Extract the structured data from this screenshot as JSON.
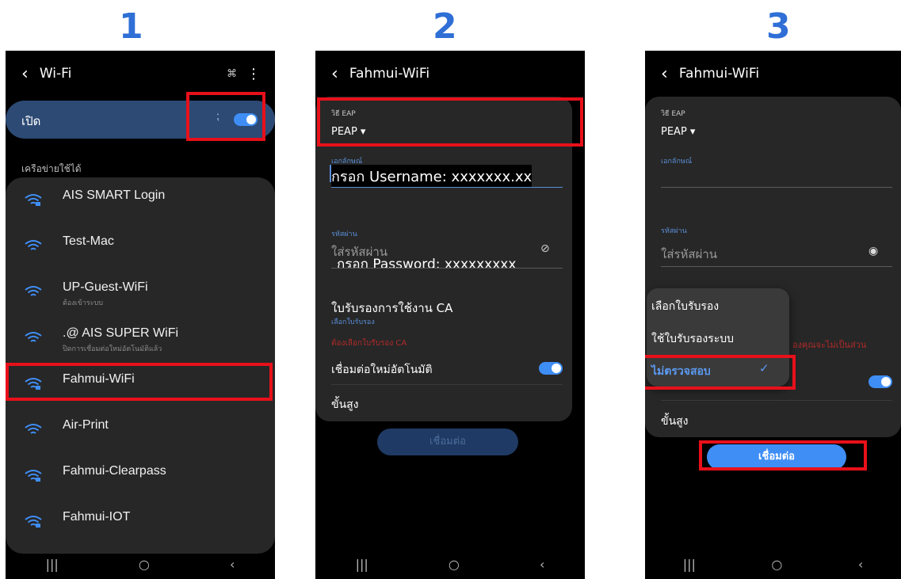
{
  "steps": [
    "1",
    "2",
    "3"
  ],
  "colors": {
    "highlight": "#e8101a",
    "accent": "#3f8ef6",
    "step_number": "#2f6fd6"
  },
  "screen1": {
    "title": "Wi-Fi",
    "toggle_label": "เปิด",
    "section_label": "เครือข่ายใช้ได้",
    "networks": [
      {
        "name": "AIS SMART Login",
        "sub": "",
        "icon": "wifi-secure-icon"
      },
      {
        "name": "Test-Mac",
        "sub": "",
        "icon": "wifi-icon"
      },
      {
        "name": "UP-Guest-WiFi",
        "sub": "ต้องเข้าระบบ",
        "icon": "wifi-icon"
      },
      {
        "name": ".@ AIS SUPER WiFi",
        "sub": "ปิดการเชื่อมต่อใหม่อัตโนมัติแล้ว",
        "icon": "wifi-icon"
      },
      {
        "name": "Fahmui-WiFi",
        "sub": "",
        "icon": "wifi-secure-icon"
      },
      {
        "name": "Air-Print",
        "sub": "",
        "icon": "wifi-icon"
      },
      {
        "name": "Fahmui-Clearpass",
        "sub": "",
        "icon": "wifi-secure-icon"
      },
      {
        "name": "Fahmui-IOT",
        "sub": "",
        "icon": "wifi-secure-icon"
      }
    ]
  },
  "screen2": {
    "title": "Fahmui-WiFi",
    "eap_label": "วิธี EAP",
    "eap_value": "PEAP ▾",
    "identity_label": "เอกลักษณ์",
    "identity_value": "กรอก Username: xxxxxxx.xx",
    "password_label": "รหัสผ่าน",
    "password_placeholder": "ใส่รหัสผ่าน",
    "password_overlay": "กรอก Password: xxxxxxxxx",
    "ca_title": "ใบรับรองการใช้งาน CA",
    "ca_sub": "เลือกใบรับรอง",
    "ca_error": "ต้องเลือกใบรับรอง CA",
    "auto_reconnect": "เชื่อมต่อใหม่อัตโนมัติ",
    "advanced": "ขั้นสูง",
    "connect_button": "เชื่อมต่อ"
  },
  "screen3": {
    "title": "Fahmui-WiFi",
    "eap_label": "วิธี EAP",
    "eap_value": "PEAP ▾",
    "identity_label": "เอกลักษณ์",
    "password_label": "รหัสผ่าน",
    "password_placeholder": "ใส่รหัสผ่าน",
    "warning_fragment": "องคุณจะไม่เป็นส่วน",
    "dropdown": [
      "เลือกใบรับรอง",
      "ใช้ใบรับรองระบบ",
      "ไม่ตรวจสอบ"
    ],
    "dropdown_selected": "ไม่ตรวจสอบ",
    "advanced": "ขั้นสูง",
    "connect_button": "เชื่อมต่อ"
  },
  "nav": {
    "recents": "|||",
    "home": "○",
    "back": "‹"
  }
}
